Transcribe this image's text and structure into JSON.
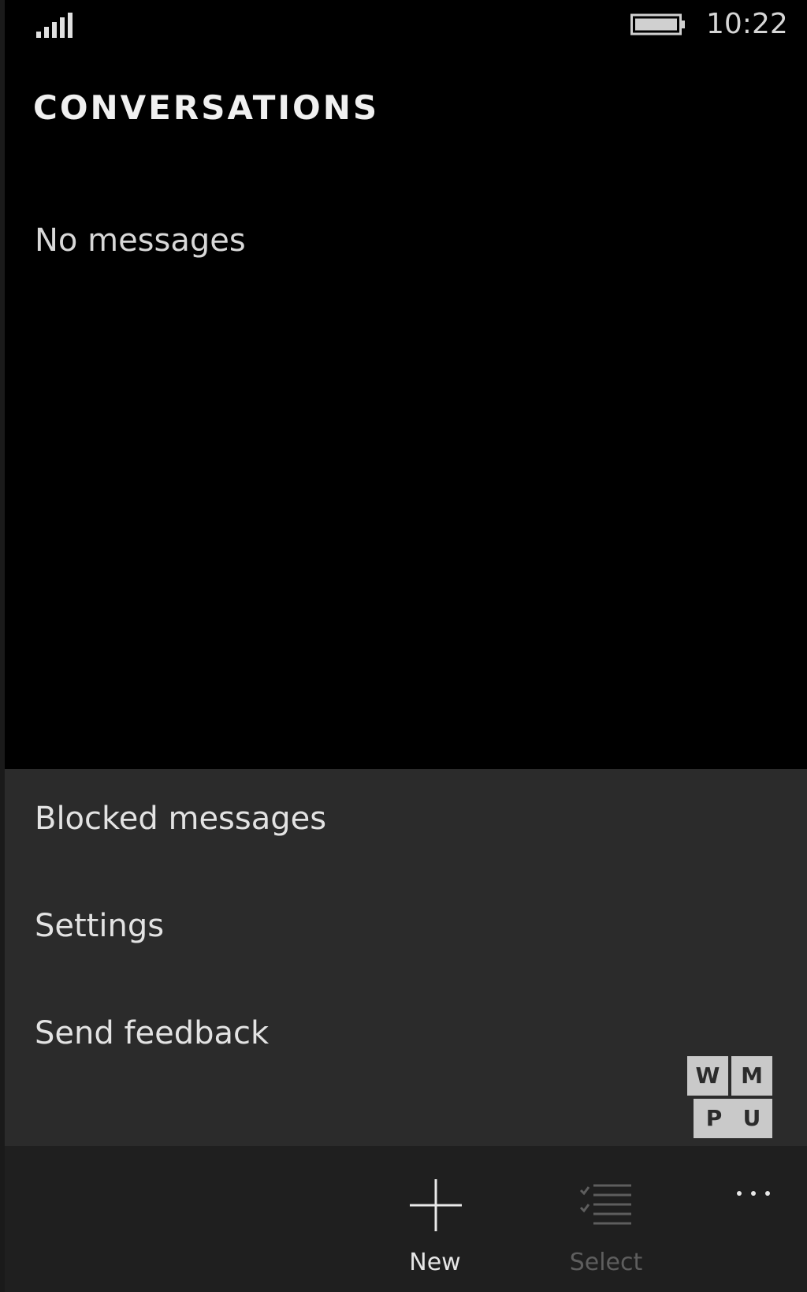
{
  "status_bar": {
    "signal_icon": "signal-strength-icon",
    "battery_icon": "battery-icon",
    "time": "10:22"
  },
  "page": {
    "title": "CONVERSATIONS",
    "empty_message": "No messages"
  },
  "menu": {
    "items": [
      {
        "label": "Blocked messages"
      },
      {
        "label": "Settings"
      },
      {
        "label": "Send feedback"
      }
    ]
  },
  "watermark": {
    "letters": [
      "W",
      "M",
      "P",
      "U"
    ]
  },
  "app_bar": {
    "new_label": "New",
    "new_icon": "plus-icon",
    "select_label": "Select",
    "select_icon": "select-list-icon",
    "select_enabled": false,
    "more_icon": "ellipsis-icon"
  },
  "colors": {
    "background": "#000000",
    "menu_background": "#2b2b2b",
    "app_bar_background": "#1f1f1f",
    "text": "#e6e6e6",
    "disabled_text": "#5e5e5e"
  }
}
